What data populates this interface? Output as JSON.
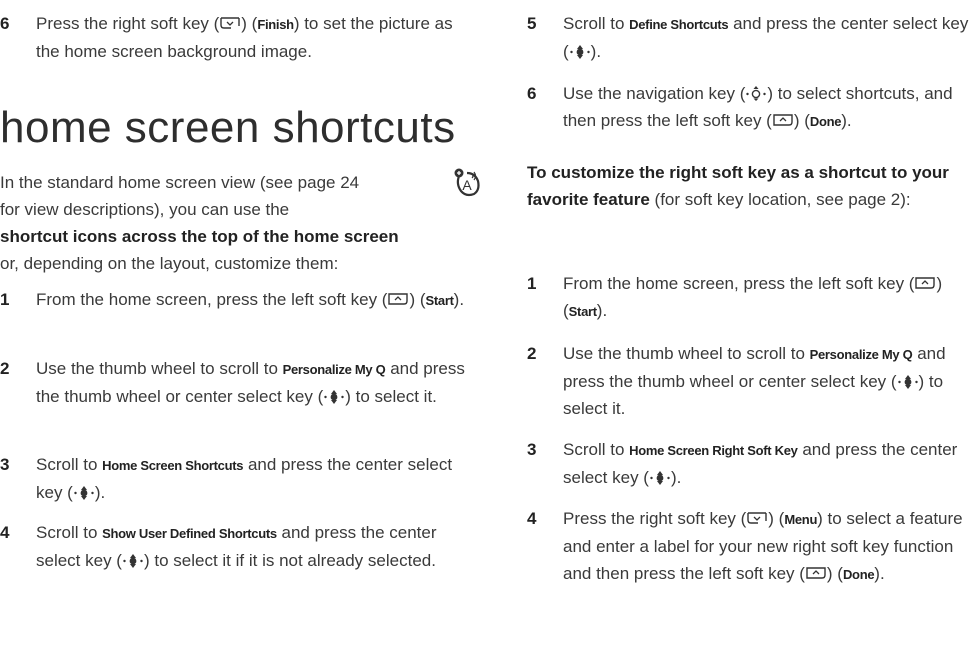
{
  "left": {
    "step6": {
      "num": "6",
      "pre": "Press the right soft key (",
      "mid": ") (",
      "key_label": "Finish",
      "post": ") to set the picture as the home screen background image."
    },
    "heading": "home screen shortcuts",
    "intro": {
      "line1": "In the standard home screen view (see page 24",
      "line2": "for view descriptions), you can use the",
      "bold": "shortcut icons across the top of the home screen",
      "line4": "or, depending on the layout, customize them:"
    },
    "steps": [
      {
        "num": "1",
        "pre": "From the home screen, press the left soft key (",
        "mid": ") (",
        "key_label": "Start",
        "post": ")."
      },
      {
        "num": "2",
        "pre": "Use the thumb wheel to scroll to ",
        "menu": "Personalize My Q",
        "post": " and press the thumb wheel or center select key (",
        "end": ") to select it."
      },
      {
        "num": "3",
        "pre": "Scroll to ",
        "menu": "Home Screen Shortcuts",
        "post": " and press the center select key (",
        "end": ")."
      },
      {
        "num": "4",
        "pre": "Scroll to ",
        "menu": "Show User Defined Shortcuts",
        "post": " and press the center select key (",
        "end": ") to select it if it is not already selected."
      }
    ]
  },
  "right": {
    "step5": {
      "num": "5",
      "pre": "Scroll to ",
      "menu": "Define Shortcuts",
      "post": " and press the center select key (",
      "end": ")."
    },
    "step6": {
      "num": "6",
      "pre": "Use the navigation key (",
      "mid": ") to select shortcuts, and then press the left soft key (",
      "mid2": ") (",
      "key_label": "Done",
      "end": ")."
    },
    "custom": {
      "bold": "To customize the right soft key as a shortcut to your favorite feature",
      "rest": " (for soft key location, see page 2):"
    },
    "steps": [
      {
        "num": "1",
        "pre": "From the home screen, press the left soft key (",
        "mid": ") (",
        "key_label": "Start",
        "post": ")."
      },
      {
        "num": "2",
        "pre": "Use the thumb wheel to scroll to ",
        "menu": "Personalize My Q",
        "post": " and press the thumb wheel or center select key (",
        "end": ") to select it."
      },
      {
        "num": "3",
        "pre": "Scroll to ",
        "menu": "Home Screen Right Soft Key",
        "post": " and press the center select key (",
        "end": ")."
      },
      {
        "num": "4",
        "pre": "Press the right soft key (",
        "mid": ") (",
        "key_label": "Menu",
        "post": ") to select a feature and enter a label for your new right soft key function and then press the left soft key (",
        "mid2": ") (",
        "key_label2": "Done",
        "end": ")."
      }
    ]
  }
}
